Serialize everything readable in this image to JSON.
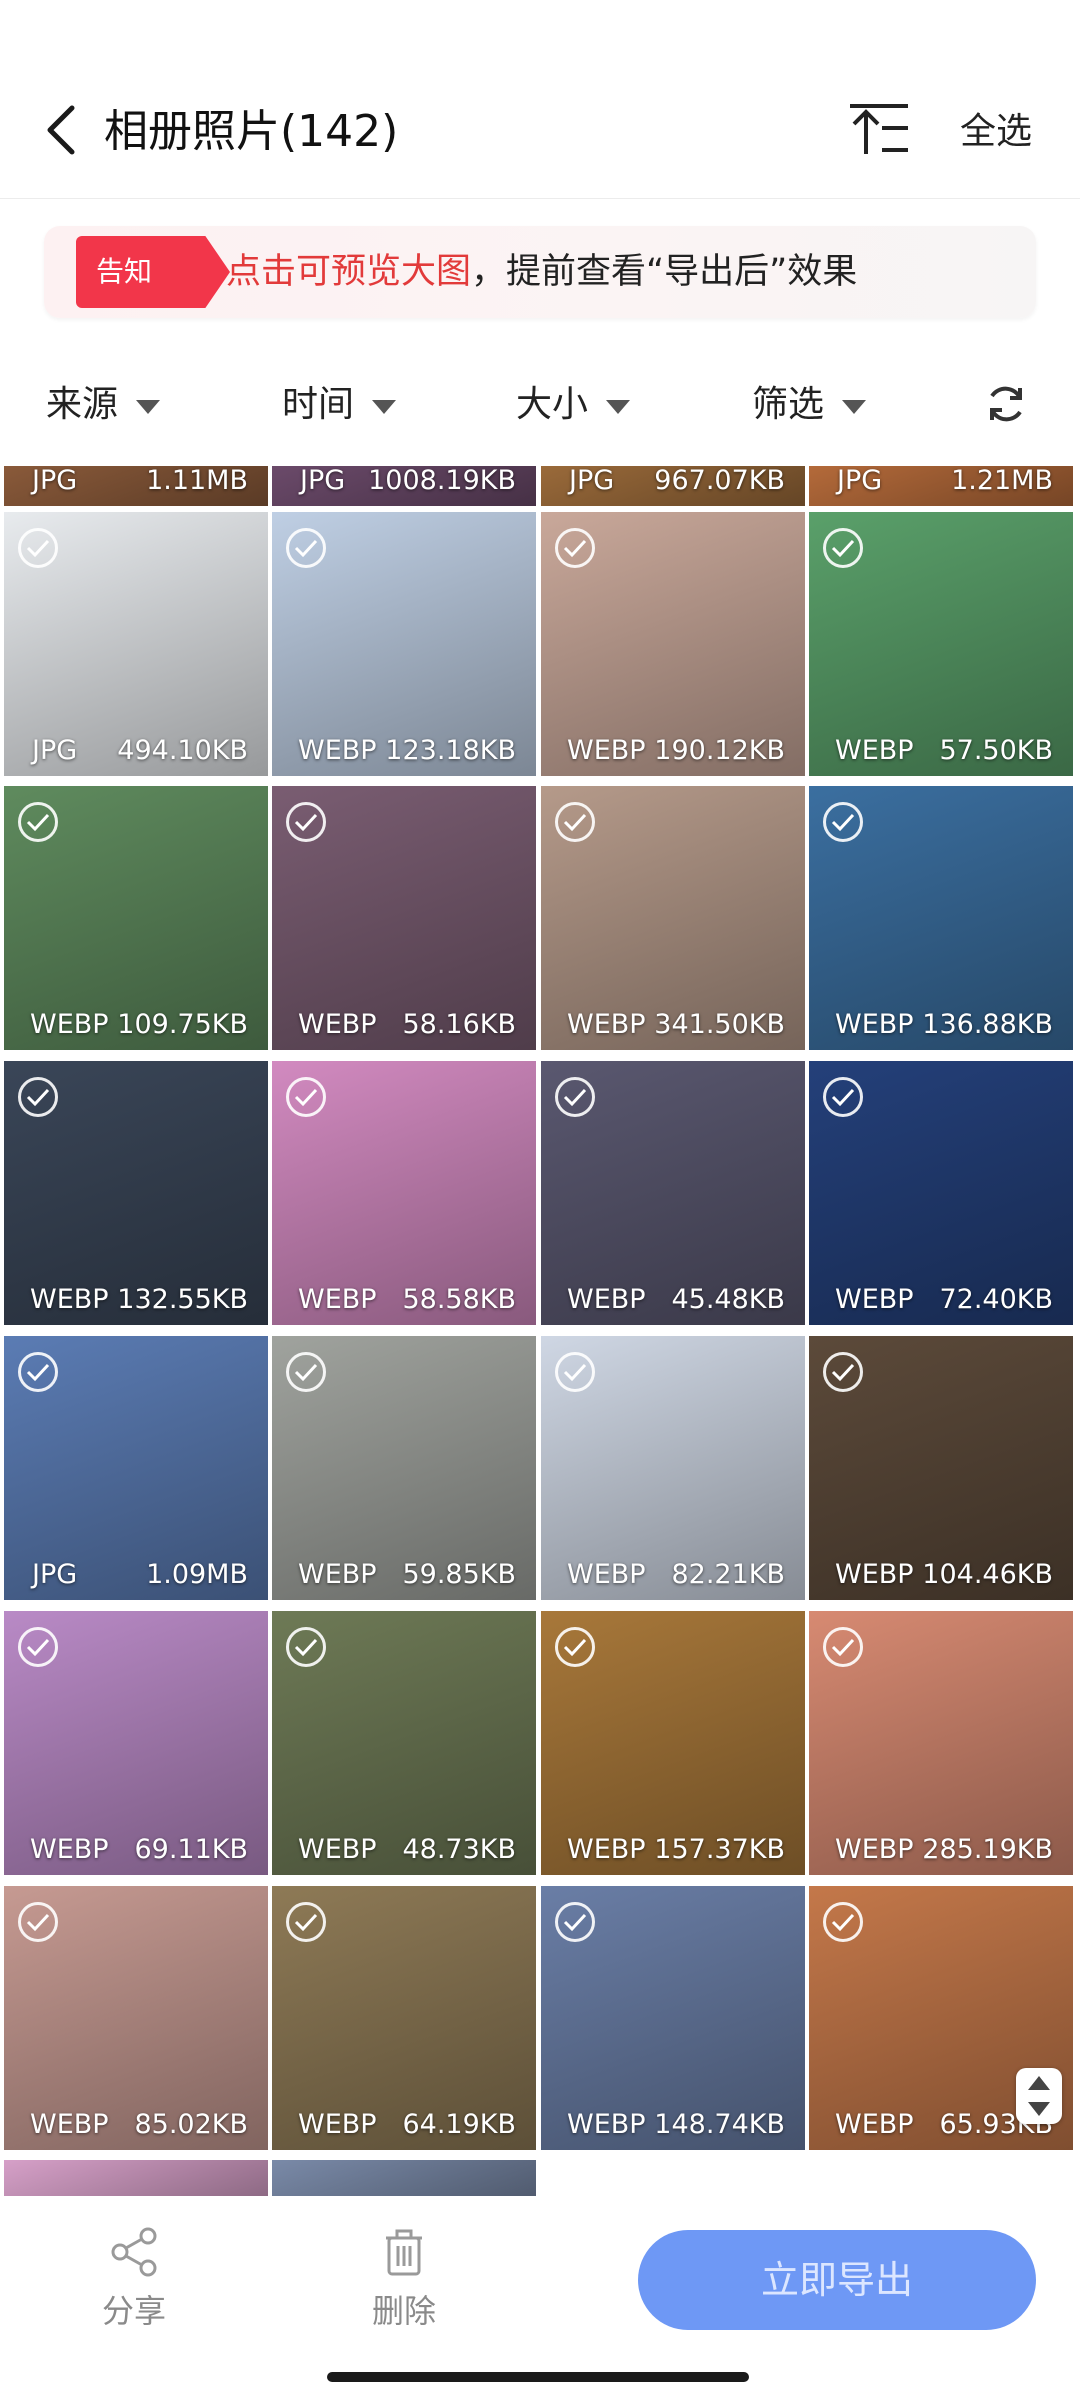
{
  "header": {
    "title": "相册照片(142)",
    "select_all": "全选",
    "back_icon": "chevron-left-icon",
    "sort_icon": "sort-icon"
  },
  "notice": {
    "tag": "告知",
    "highlight": "点击可预览大图",
    "text": "，提前查看“导出后”效果"
  },
  "filters": [
    {
      "label": "来源"
    },
    {
      "label": "时间"
    },
    {
      "label": "大小"
    },
    {
      "label": "筛选"
    }
  ],
  "photos": [
    {
      "type": "JPG",
      "size": "1.11MB",
      "color": "#8a5a3a"
    },
    {
      "type": "JPG",
      "size": "1008.19KB",
      "color": "#6b4a6a"
    },
    {
      "type": "JPG",
      "size": "967.07KB",
      "color": "#9a6a3a"
    },
    {
      "type": "JPG",
      "size": "1.21MB",
      "color": "#b46a3a"
    },
    {
      "type": "JPG",
      "size": "494.10KB",
      "color": "#e8ebee"
    },
    {
      "type": "WEBP",
      "size": "123.18KB",
      "color": "#bfcfe4"
    },
    {
      "type": "WEBP",
      "size": "190.12KB",
      "color": "#c9a89a"
    },
    {
      "type": "WEBP",
      "size": "57.50KB",
      "color": "#5aa06a"
    },
    {
      "type": "WEBP",
      "size": "109.75KB",
      "color": "#5f8b5e"
    },
    {
      "type": "WEBP",
      "size": "58.16KB",
      "color": "#7a5d72"
    },
    {
      "type": "WEBP",
      "size": "341.50KB",
      "color": "#b59a8a"
    },
    {
      "type": "WEBP",
      "size": "136.88KB",
      "color": "#3b6fa0"
    },
    {
      "type": "WEBP",
      "size": "132.55KB",
      "color": "#3a4658"
    },
    {
      "type": "WEBP",
      "size": "58.58KB",
      "color": "#d28ac0"
    },
    {
      "type": "WEBP",
      "size": "45.48KB",
      "color": "#5a5870"
    },
    {
      "type": "WEBP",
      "size": "72.40KB",
      "color": "#24407a"
    },
    {
      "type": "JPG",
      "size": "1.09MB",
      "color": "#5b7cb4"
    },
    {
      "type": "WEBP",
      "size": "59.85KB",
      "color": "#a0a39e"
    },
    {
      "type": "WEBP",
      "size": "82.21KB",
      "color": "#cfd7e4"
    },
    {
      "type": "WEBP",
      "size": "104.46KB",
      "color": "#5c4a3a"
    },
    {
      "type": "WEBP",
      "size": "69.11KB",
      "color": "#b98ac6"
    },
    {
      "type": "WEBP",
      "size": "48.73KB",
      "color": "#6e7a56"
    },
    {
      "type": "WEBP",
      "size": "157.37KB",
      "color": "#a8783a"
    },
    {
      "type": "WEBP",
      "size": "285.19KB",
      "color": "#d78a72"
    },
    {
      "type": "WEBP",
      "size": "85.02KB",
      "color": "#c69a92"
    },
    {
      "type": "WEBP",
      "size": "64.19KB",
      "color": "#8e7a56"
    },
    {
      "type": "WEBP",
      "size": "148.74KB",
      "color": "#6a7ea6"
    },
    {
      "type": "WEBP",
      "size": "65.93KB",
      "color": "#c4784a"
    },
    {
      "type": "",
      "size": "",
      "color": "#d6a0c8"
    },
    {
      "type": "",
      "size": "",
      "color": "#7a8aa8"
    }
  ],
  "bottom": {
    "share": "分享",
    "delete": "删除",
    "export": "立即导出"
  }
}
